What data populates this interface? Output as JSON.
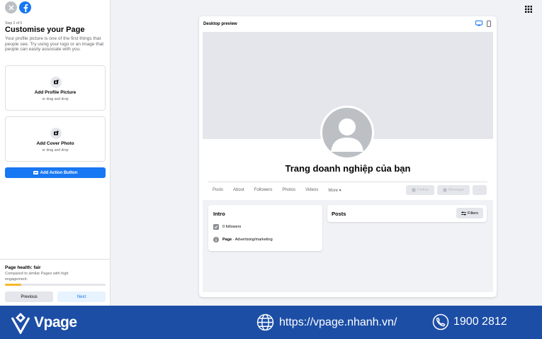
{
  "left_panel": {
    "step": "Step 2 of 5",
    "title": "Customise your Page",
    "description": "Your profile picture is one of the first things that people see. Try using your logo or an image that people can easily associate with you.",
    "profile_picture": {
      "label": "Add Profile Picture",
      "sub": "or drag and drop"
    },
    "cover_photo": {
      "label": "Add Cover Photo",
      "sub": "or drag and drop"
    },
    "action_button": "Add Action Button",
    "health": {
      "title": "Page health: fair",
      "description": "Compared to similar Pages with high engagement.",
      "progress": 0.16
    },
    "previous": "Previous",
    "next": "Next"
  },
  "preview": {
    "label": "Desktop preview",
    "page_name": "Trang doanh nghiệp của bạn",
    "tabs": [
      "Posts",
      "About",
      "Followers",
      "Photos",
      "Videos",
      "More ▾"
    ],
    "follow": "Follow",
    "message": "Message",
    "more": "···",
    "intro": {
      "title": "Intro",
      "followers": "0 followers",
      "page_label": "Page",
      "category": " · Advertising/marketing"
    },
    "posts": {
      "title": "Posts",
      "filters": "Filters"
    }
  },
  "footer": {
    "brand": "Vpage",
    "url": "https://vpage.nhanh.vn/",
    "phone": "1900 2812"
  },
  "colors": {
    "accent": "#1877f2",
    "footer": "#1c4ea6",
    "health": "#f7b928"
  }
}
